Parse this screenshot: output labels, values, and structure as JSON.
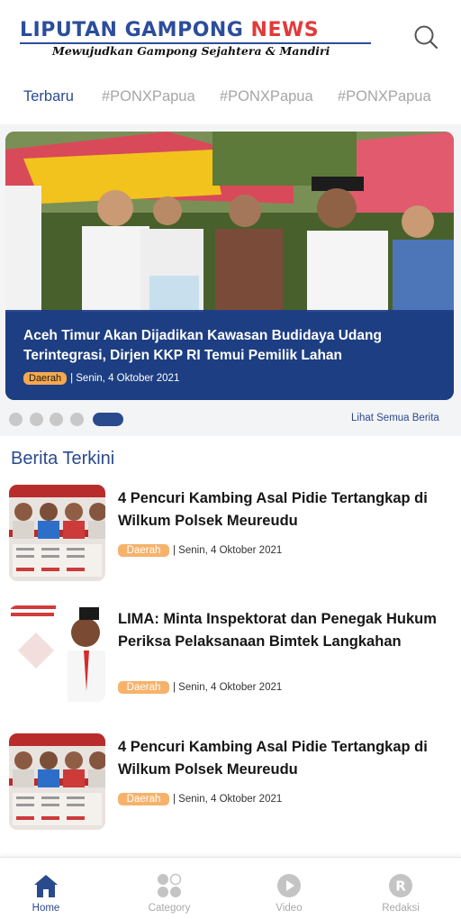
{
  "header": {
    "logo_title": "LIPUTAN GAMPONG",
    "logo_title_accent": "NEWS",
    "logo_tagline": "Mewujudkan Gampong Sejahtera & Mandiri",
    "search_icon": "search-icon"
  },
  "tabs": [
    {
      "label": "Terbaru",
      "active": true
    },
    {
      "label": "#PONXPapua",
      "active": false
    },
    {
      "label": "#PONXPapua",
      "active": false
    },
    {
      "label": "#PONXPapua",
      "active": false
    }
  ],
  "hero": {
    "title": "Aceh Timur Akan Dijadikan Kawasan Budidaya Udang Terintegrasi, Dirjen KKP RI Temui Pemilik Lahan",
    "category": "Daerah",
    "date": "| Senin, 4 Oktober 2021",
    "slide_count": 5,
    "active_slide": 5
  },
  "see_all_label": "Lihat Semua Berita",
  "section_title": "Berita Terkini",
  "news": [
    {
      "title": "4 Pencuri Kambing Asal Pidie Tertangkap di Wilkum Polsek Meureudu",
      "category": "Daerah",
      "date": "| Senin, 4 Oktober 2021"
    },
    {
      "title": "LIMA: Minta Inspektorat dan Penegak Hukum Periksa Pelaksanaan Bimtek Langkahan",
      "category": "Daerah",
      "date": "| Senin, 4 Oktober 2021"
    },
    {
      "title": "4 Pencuri Kambing Asal Pidie Tertangkap di Wilkum Polsek Meureudu",
      "category": "Daerah",
      "date": "| Senin, 4 Oktober 2021"
    }
  ],
  "bottom_nav": [
    {
      "label": "Home",
      "icon": "home-icon",
      "active": true
    },
    {
      "label": "Category",
      "icon": "category-icon",
      "active": false
    },
    {
      "label": "Video",
      "icon": "play-icon",
      "active": false
    },
    {
      "label": "Redaksi",
      "icon": "redaksi-icon",
      "active": false
    }
  ],
  "colors": {
    "brand_blue": "#2a4a8e",
    "accent_red": "#e23a3a",
    "badge_orange": "#f6b26b",
    "inactive_gray": "#a9a9a9"
  }
}
